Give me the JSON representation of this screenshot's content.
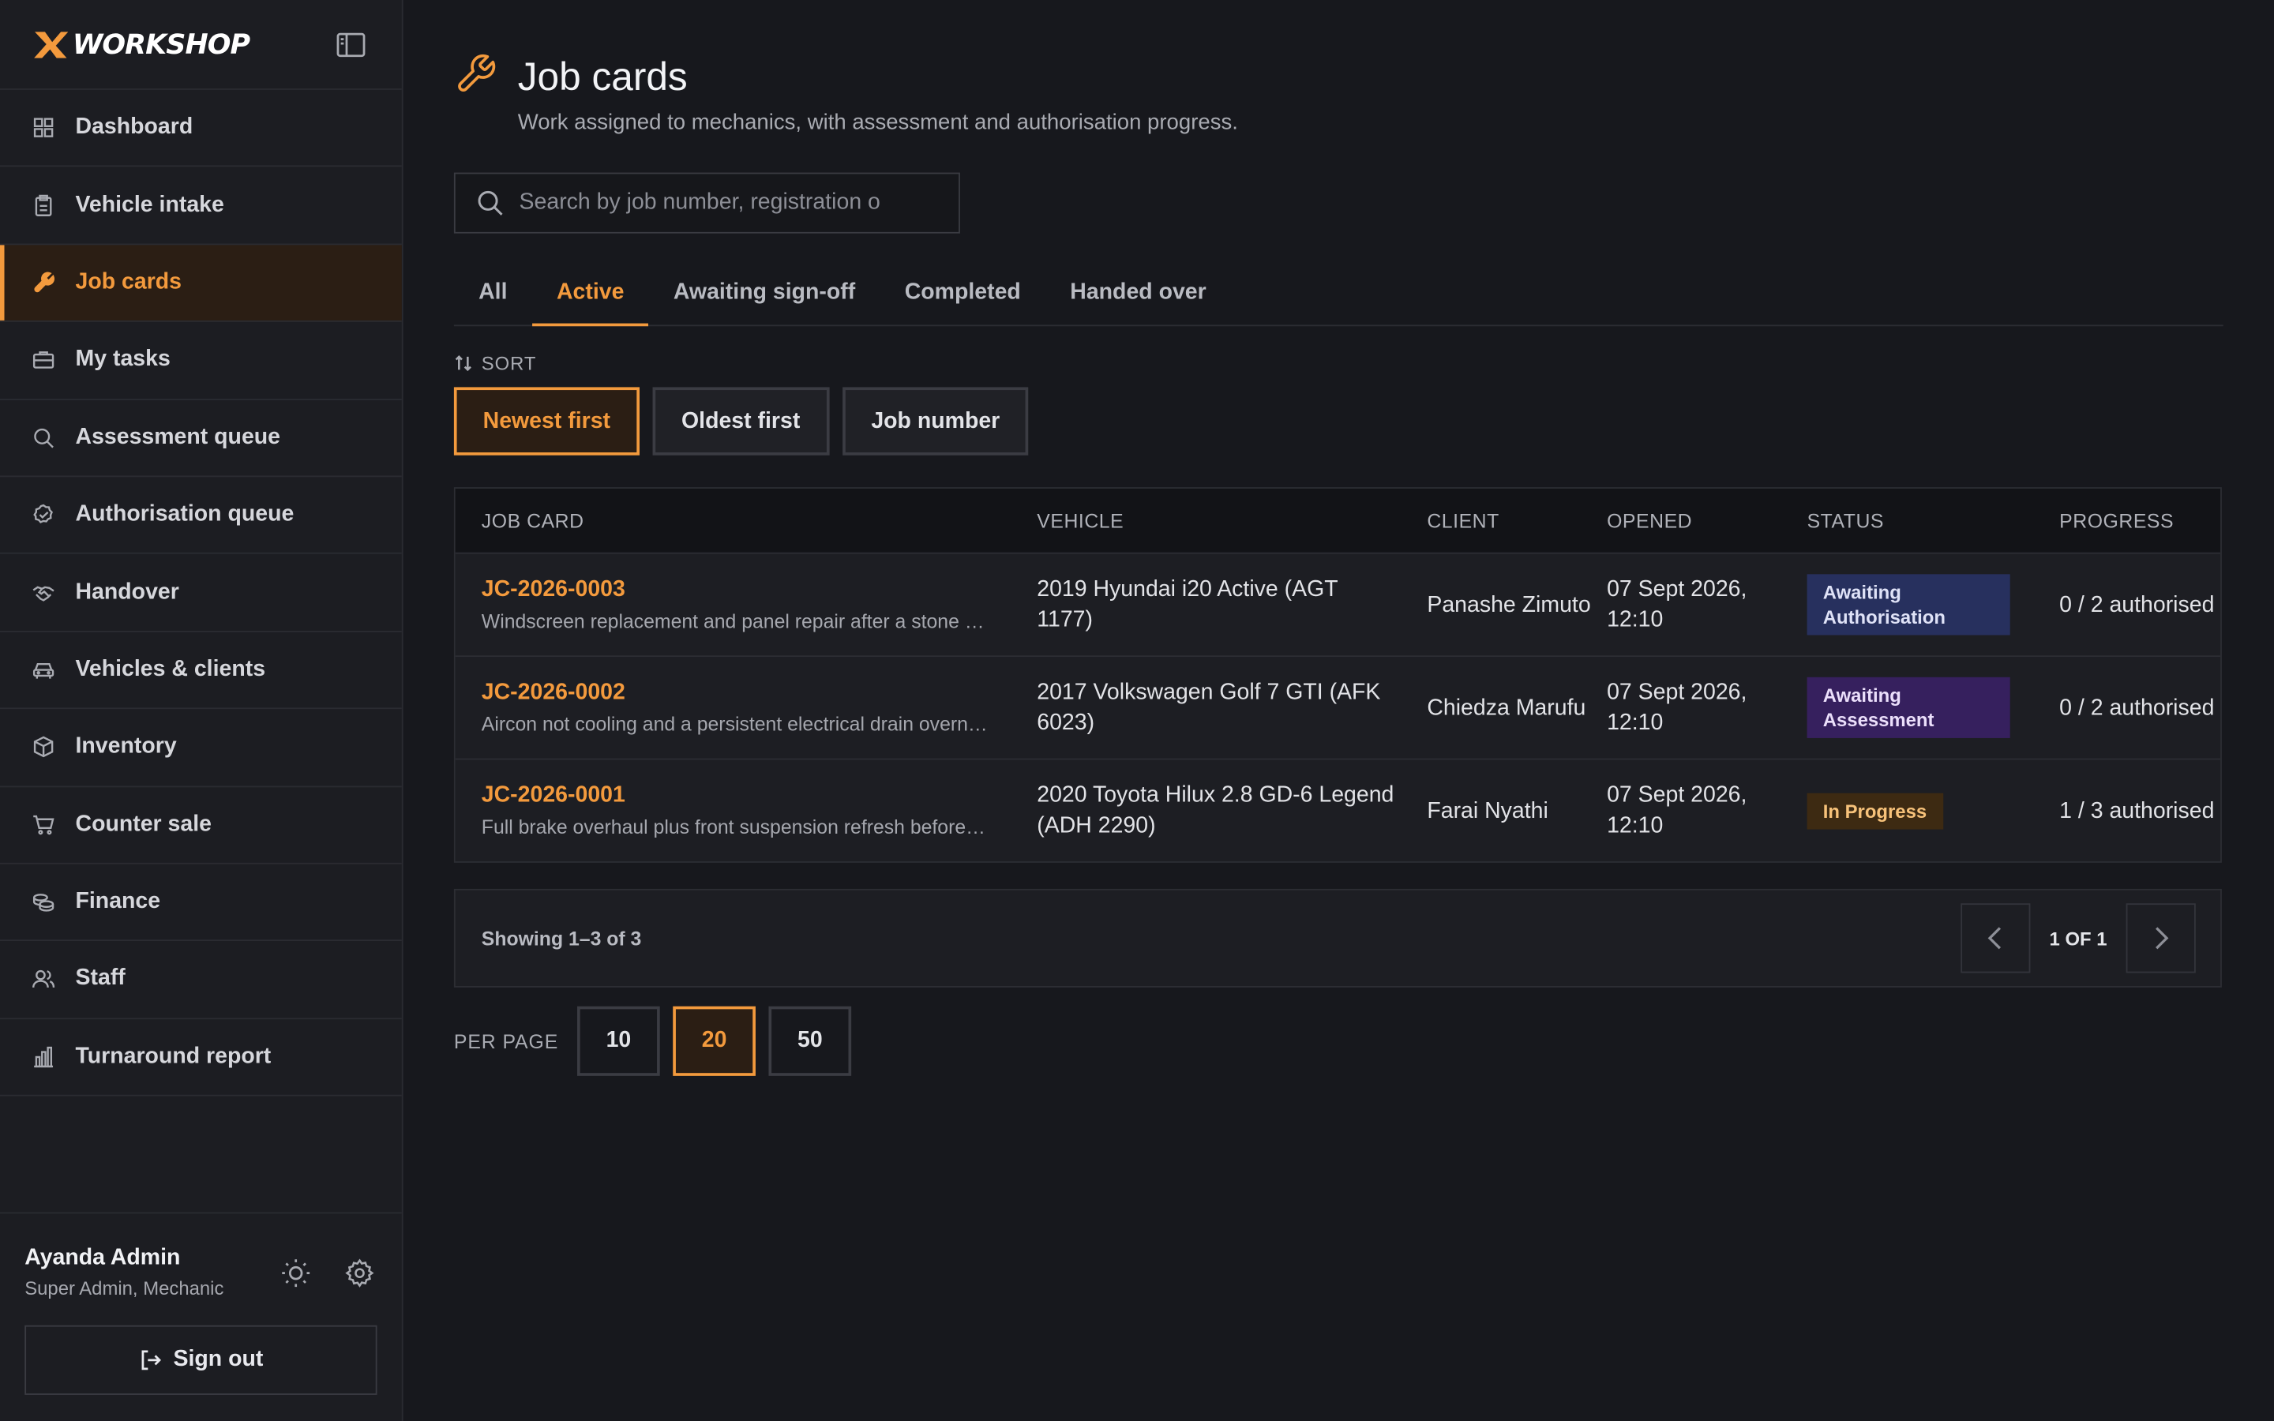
{
  "app": {
    "brand": "WORKSHOP",
    "accent": "#f39a3d"
  },
  "sidebar": {
    "items": [
      {
        "label": "Dashboard",
        "icon": "grid-icon"
      },
      {
        "label": "Vehicle intake",
        "icon": "clipboard-icon"
      },
      {
        "label": "Job cards",
        "icon": "wrench-icon",
        "active": true
      },
      {
        "label": "My tasks",
        "icon": "briefcase-icon"
      },
      {
        "label": "Assessment queue",
        "icon": "search-icon"
      },
      {
        "label": "Authorisation queue",
        "icon": "check-badge-icon"
      },
      {
        "label": "Handover",
        "icon": "handshake-icon"
      },
      {
        "label": "Vehicles & clients",
        "icon": "car-icon"
      },
      {
        "label": "Inventory",
        "icon": "box-icon"
      },
      {
        "label": "Counter sale",
        "icon": "cart-icon"
      },
      {
        "label": "Finance",
        "icon": "coins-icon"
      },
      {
        "label": "Staff",
        "icon": "users-icon"
      },
      {
        "label": "Turnaround report",
        "icon": "bar-chart-icon"
      }
    ],
    "user": {
      "name": "Ayanda Admin",
      "role": "Super Admin, Mechanic"
    },
    "signout_label": "Sign out"
  },
  "page": {
    "title": "Job cards",
    "subtitle": "Work assigned to mechanics, with assessment and authorisation progress."
  },
  "search": {
    "placeholder": "Search by job number, registration o",
    "value": ""
  },
  "tabs": [
    {
      "label": "All"
    },
    {
      "label": "Active",
      "active": true
    },
    {
      "label": "Awaiting sign-off"
    },
    {
      "label": "Completed"
    },
    {
      "label": "Handed over"
    }
  ],
  "sort": {
    "label": "SORT",
    "options": [
      {
        "label": "Newest first",
        "active": true
      },
      {
        "label": "Oldest first"
      },
      {
        "label": "Job number"
      }
    ]
  },
  "table": {
    "headers": [
      "JOB CARD",
      "VEHICLE",
      "CLIENT",
      "OPENED",
      "STATUS",
      "PROGRESS"
    ],
    "rows": [
      {
        "job": "JC-2026-0003",
        "desc": "Windscreen replacement and panel repair after a stone stri...",
        "vehicle": "2019 Hyundai i20 Active (AGT 1177)",
        "client": "Panashe Zimuto",
        "opened": "07 Sept 2026, 12:10",
        "status": "Awaiting Authorisation",
        "progress": "0 / 2 authorised"
      },
      {
        "job": "JC-2026-0002",
        "desc": "Aircon not cooling and a persistent electrical drain overnig...",
        "vehicle": "2017 Volkswagen Golf 7 GTI (AFK 6023)",
        "client": "Chiedza Marufu",
        "opened": "07 Sept 2026, 12:10",
        "status": "Awaiting Assessment",
        "progress": "0 / 2 authorised"
      },
      {
        "job": "JC-2026-0001",
        "desc": "Full brake overhaul plus front suspension refresh before th...",
        "vehicle": "2020 Toyota Hilux 2.8 GD-6 Legend (ADH 2290)",
        "client": "Farai Nyathi",
        "opened": "07 Sept 2026, 12:10",
        "status": "In Progress",
        "progress": "1 / 3 authorised"
      }
    ]
  },
  "pager": {
    "showing": "Showing 1–3 of 3",
    "page_label": "1 OF 1"
  },
  "per_page": {
    "label": "PER PAGE",
    "options": [
      "10",
      "20",
      "50"
    ],
    "selected": "20"
  }
}
